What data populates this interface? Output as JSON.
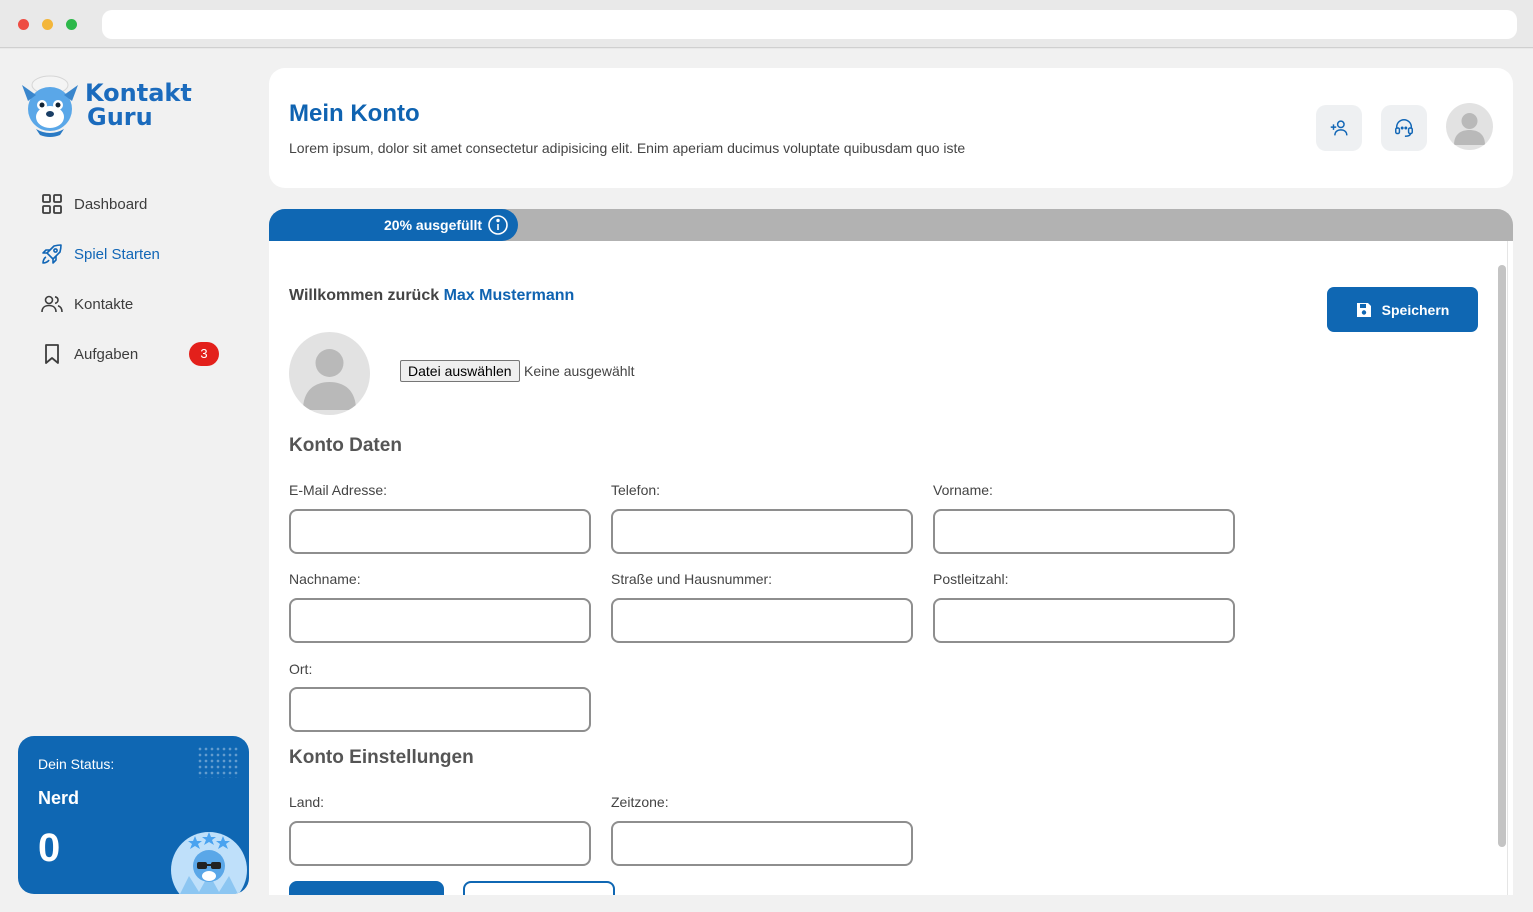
{
  "brand": {
    "line1": "Kontakt",
    "line2": "Guru",
    "color": "#1b6bbd"
  },
  "sidebar": {
    "items": [
      {
        "label": "Dashboard",
        "icon": "grid-icon"
      },
      {
        "label": "Spiel Starten",
        "icon": "rocket-icon",
        "active": true
      },
      {
        "label": "Kontakte",
        "icon": "users-icon"
      },
      {
        "label": "Aufgaben",
        "icon": "bookmark-icon",
        "badge": "3"
      }
    ]
  },
  "status": {
    "label": "Dein Status:",
    "name": "Nerd",
    "score": "0"
  },
  "header": {
    "title": "Mein Konto",
    "subtitle": "Lorem ipsum, dolor sit amet consectetur adipisicing elit. Enim aperiam ducimus voluptate quibusdam quo iste",
    "actions": [
      "add-user-icon",
      "headset-icon"
    ]
  },
  "progress": {
    "label": "20% ausgefüllt",
    "fraction": 0.2
  },
  "main": {
    "welcome_prefix": "Willkommen zurück",
    "username": "Max Mustermann",
    "save_label": "Speichern",
    "file_button": "Datei auswählen",
    "file_status": "Keine ausgewählt",
    "account_section": "Konto Daten",
    "settings_section": "Konto Einstellungen",
    "fields": {
      "email": {
        "label": "E-Mail Adresse:",
        "value": ""
      },
      "phone": {
        "label": "Telefon:",
        "value": ""
      },
      "firstname": {
        "label": "Vorname:",
        "value": ""
      },
      "lastname": {
        "label": "Nachname:",
        "value": ""
      },
      "street": {
        "label": "Straße und Hausnummer:",
        "value": ""
      },
      "zip": {
        "label": "Postleitzahl:",
        "value": ""
      },
      "city": {
        "label": "Ort:",
        "value": ""
      },
      "country": {
        "label": "Land:",
        "value": ""
      },
      "timezone": {
        "label": "Zeitzone:",
        "value": ""
      }
    }
  },
  "colors": {
    "primary": "#0f67b3",
    "badge": "#e3201b",
    "progress_track": "#b2b2b2"
  }
}
